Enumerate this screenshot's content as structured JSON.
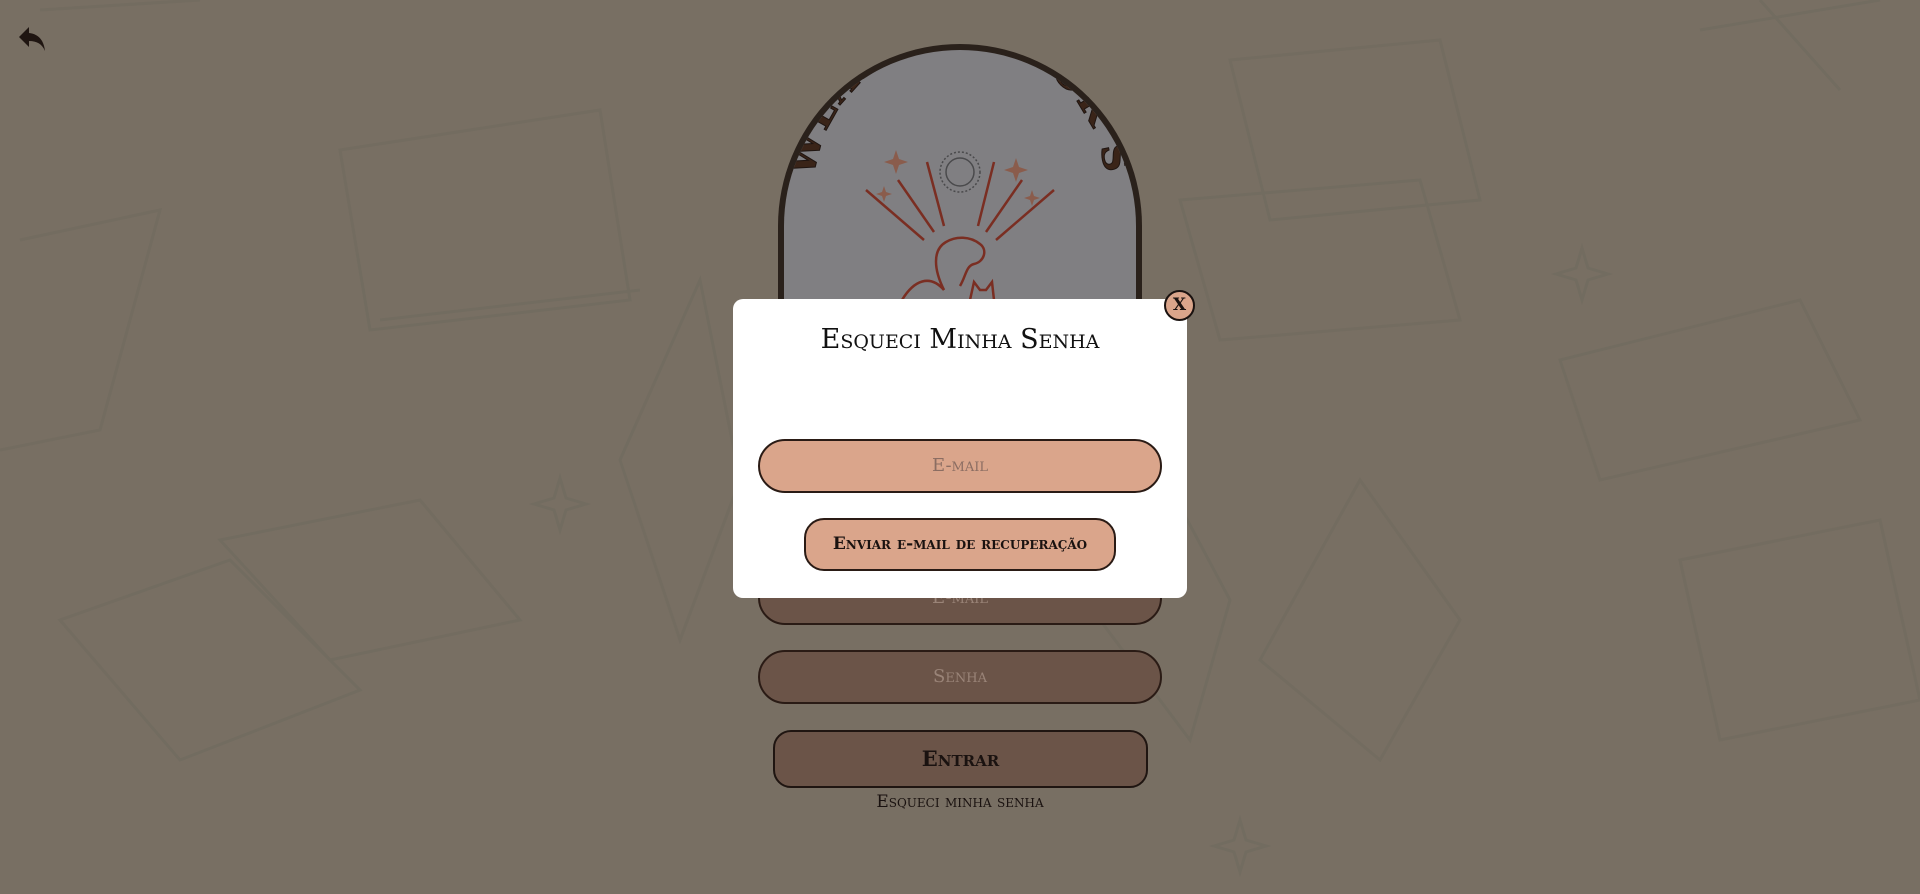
{
  "page": {
    "background_color": "#786f63",
    "accent_color": "#daa58b",
    "dim_button_color": "#6b5448"
  },
  "header": {
    "back_icon": "back-arrow-icon"
  },
  "logo": {
    "brand_text": "WLAMEL BOOK'S",
    "icons": [
      "sun-icon",
      "sparkle-icon",
      "dog-icon",
      "cat-icon"
    ]
  },
  "login": {
    "email_placeholder": "E-mail",
    "password_placeholder": "Senha",
    "submit_label": "Entrar",
    "forgot_link": "Esqueci minha senha"
  },
  "modal": {
    "title": "Esqueci Minha Senha",
    "email_placeholder": "E-mail",
    "send_label": "Enviar e-mail de recuperação",
    "close_label": "X"
  }
}
